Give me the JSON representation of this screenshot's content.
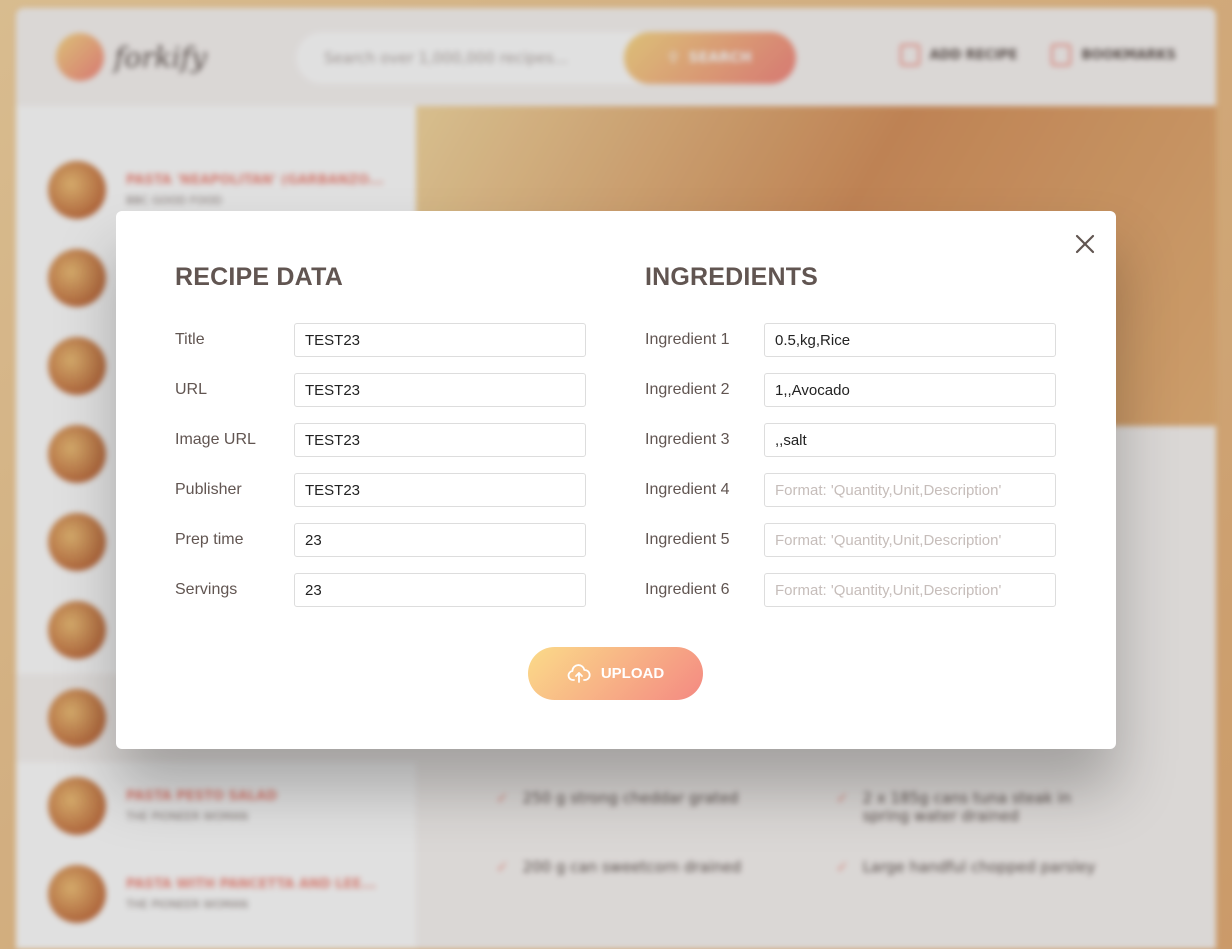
{
  "background": {
    "logo_text": "forkify",
    "search_placeholder": "Search over 1,000,000 recipes...",
    "search_button": "SEARCH",
    "nav_add_recipe": "ADD RECIPE",
    "nav_bookmarks": "BOOKMARKS",
    "results": [
      {
        "title": "PASTA 'NEAPOLITAN' (GARBANZO...",
        "publisher": "BBC GOOD FOOD"
      },
      {
        "title": "",
        "publisher": ""
      },
      {
        "title": "",
        "publisher": ""
      },
      {
        "title": "",
        "publisher": ""
      },
      {
        "title": "",
        "publisher": ""
      },
      {
        "title": "",
        "publisher": ""
      },
      {
        "title": "",
        "publisher": ""
      },
      {
        "title": "PASTA PESTO SALAD",
        "publisher": "THE PIONEER WOMAN"
      },
      {
        "title": "PASTA WITH PANCETTA AND LEE...",
        "publisher": "THE PIONEER WOMAN"
      }
    ],
    "ingredients": [
      "250 g strong cheddar grated",
      "2 x 185g cans tuna steak in spring water drained",
      "200 g can sweetcorn drained",
      "Large handful chopped parsley"
    ]
  },
  "modal": {
    "recipe_heading": "RECIPE DATA",
    "ingredients_heading": "INGREDIENTS",
    "recipe_fields": [
      {
        "label": "Title",
        "value": "TEST23",
        "placeholder": ""
      },
      {
        "label": "URL",
        "value": "TEST23",
        "placeholder": ""
      },
      {
        "label": "Image URL",
        "value": "TEST23",
        "placeholder": ""
      },
      {
        "label": "Publisher",
        "value": "TEST23",
        "placeholder": ""
      },
      {
        "label": "Prep time",
        "value": "23",
        "placeholder": ""
      },
      {
        "label": "Servings",
        "value": "23",
        "placeholder": ""
      }
    ],
    "ingredient_fields": [
      {
        "label": "Ingredient 1",
        "value": "0.5,kg,Rice",
        "placeholder": ""
      },
      {
        "label": "Ingredient 2",
        "value": "1,,Avocado",
        "placeholder": ""
      },
      {
        "label": "Ingredient 3",
        "value": ",,salt",
        "placeholder": ""
      },
      {
        "label": "Ingredient 4",
        "value": "",
        "placeholder": "Format: 'Quantity,Unit,Description'"
      },
      {
        "label": "Ingredient 5",
        "value": "",
        "placeholder": "Format: 'Quantity,Unit,Description'"
      },
      {
        "label": "Ingredient 6",
        "value": "",
        "placeholder": "Format: 'Quantity,Unit,Description'"
      }
    ],
    "upload_label": "UPLOAD",
    "close_icon": "close-icon",
    "upload_icon": "cloud-upload-icon"
  },
  "colors": {
    "accent_start": "#fbdb89",
    "accent_end": "#f48982",
    "text": "#615551"
  }
}
